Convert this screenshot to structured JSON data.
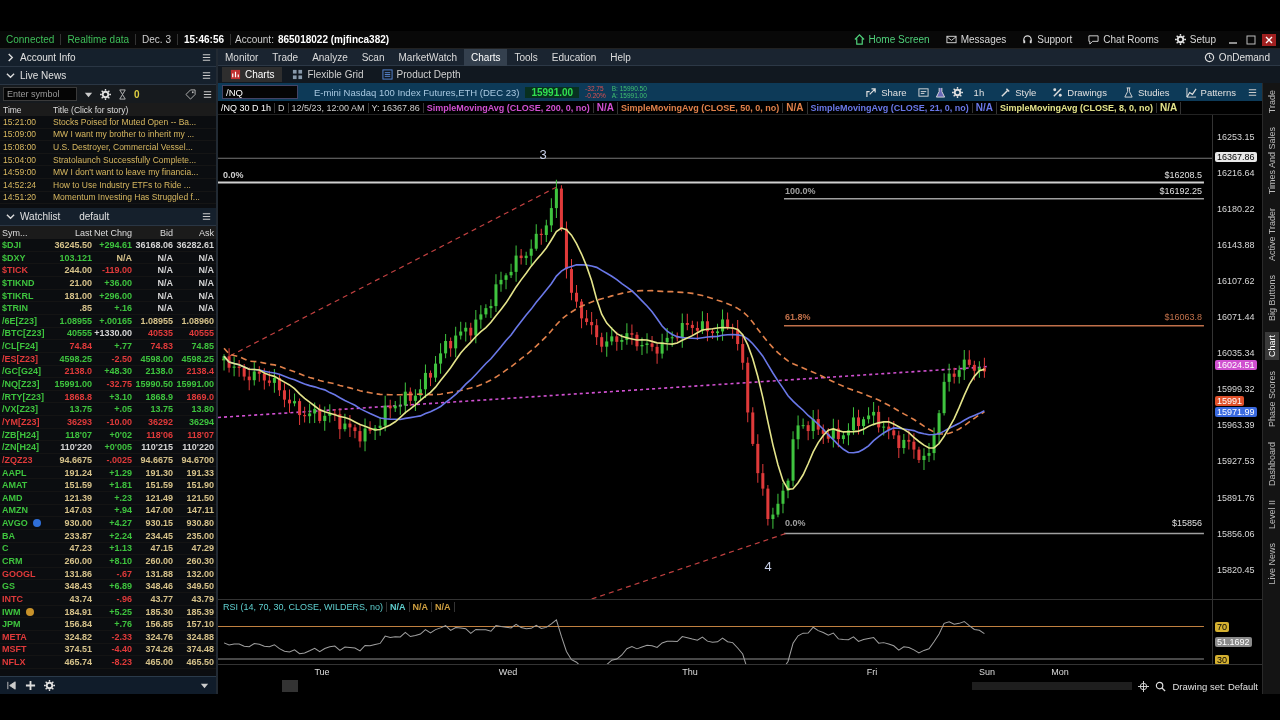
{
  "status_bar": {
    "connection": "Connected",
    "data_feed": "Realtime data",
    "date": "Dec. 3",
    "time": "15:46:56",
    "account_label": "Account:",
    "account": "865018022 (mjfinca382)"
  },
  "top_links": [
    {
      "label": "Home Screen",
      "kind": "home"
    },
    {
      "label": "Messages",
      "kind": "mail"
    },
    {
      "label": "Support",
      "kind": "headset"
    },
    {
      "label": "Chat Rooms",
      "kind": "chat"
    },
    {
      "label": "Setup",
      "kind": "gear"
    }
  ],
  "left_panel": {
    "sections": [
      {
        "title": "Account Info",
        "expanded": false
      },
      {
        "title": "Live News",
        "expanded": true
      }
    ],
    "symbol_field": {
      "placeholder": "Enter symbol"
    },
    "alert_count": "0",
    "news": {
      "columns": [
        "Time",
        "Title (Click for story)"
      ],
      "rows": [
        {
          "time": "15:21:00",
          "title": "Stocks Poised for Muted Open -- Ba..."
        },
        {
          "time": "15:09:00",
          "title": "MW I want my brother to inherit my ..."
        },
        {
          "time": "15:08:00",
          "title": "U.S. Destroyer, Commercial Vessel..."
        },
        {
          "time": "15:04:00",
          "title": "Stratolaunch Successfully Complete..."
        },
        {
          "time": "14:59:00",
          "title": "MW I don't want to leave my financia..."
        },
        {
          "time": "14:52:24",
          "title": "How to Use Industry ETFs to Ride ..."
        },
        {
          "time": "14:51:20",
          "title": "Momentum Investing Has Struggled f..."
        }
      ]
    },
    "watchlist": {
      "title": "Watchlist",
      "name": "default",
      "columns": [
        "Sym...",
        "Last",
        "Net Chng",
        "Bid",
        "Ask"
      ],
      "rows": [
        {
          "cells": [
            {
              "text": "$DJI",
              "color": "#3ec43e"
            },
            {
              "text": "36245.50",
              "color": "#d6c28a"
            },
            {
              "text": "+294.61",
              "color": "#3ec43e"
            },
            {
              "text": "36168.06",
              "color": "#d4d4d4"
            },
            {
              "text": "36282.61",
              "color": "#d4d4d4"
            }
          ]
        },
        {
          "cells": [
            {
              "text": "$DXY",
              "color": "#3ec43e"
            },
            {
              "text": "103.121",
              "color": "#3ec43e"
            },
            {
              "text": "N/A",
              "color": "#d6c28a"
            },
            {
              "text": "N/A",
              "color": "#d4d4d4"
            },
            {
              "text": "N/A",
              "color": "#d4d4d4"
            }
          ]
        },
        {
          "cells": [
            {
              "text": "$TICK",
              "color": "#e03a3a"
            },
            {
              "text": "244.00",
              "color": "#d6c28a"
            },
            {
              "text": "-119.00",
              "color": "#e03a3a"
            },
            {
              "text": "N/A",
              "color": "#d4d4d4"
            },
            {
              "text": "N/A",
              "color": "#d4d4d4"
            }
          ]
        },
        {
          "cells": [
            {
              "text": "$TIKND",
              "color": "#3ec43e"
            },
            {
              "text": "21.00",
              "color": "#d6c28a"
            },
            {
              "text": "+36.00",
              "color": "#3ec43e"
            },
            {
              "text": "N/A",
              "color": "#d4d4d4"
            },
            {
              "text": "N/A",
              "color": "#d4d4d4"
            }
          ]
        },
        {
          "cells": [
            {
              "text": "$TIKRL",
              "color": "#3ec43e"
            },
            {
              "text": "181.00",
              "color": "#d6c28a"
            },
            {
              "text": "+296.00",
              "color": "#3ec43e"
            },
            {
              "text": "N/A",
              "color": "#d4d4d4"
            },
            {
              "text": "N/A",
              "color": "#d4d4d4"
            }
          ]
        },
        {
          "cells": [
            {
              "text": "$TRIN",
              "color": "#3ec43e"
            },
            {
              "text": ".85",
              "color": "#d6c28a"
            },
            {
              "text": "+.16",
              "color": "#3ec43e"
            },
            {
              "text": "N/A",
              "color": "#d4d4d4"
            },
            {
              "text": "N/A",
              "color": "#d4d4d4"
            }
          ]
        },
        {
          "cells": [
            {
              "text": "/6E[Z23]",
              "color": "#3ec43e"
            },
            {
              "text": "1.08955",
              "color": "#3ec43e"
            },
            {
              "text": "+.00165",
              "color": "#3ec43e"
            },
            {
              "text": "1.08955",
              "color": "#d6c28a"
            },
            {
              "text": "1.08960",
              "color": "#d6c28a"
            }
          ]
        },
        {
          "cells": [
            {
              "text": "/BTC[Z23]",
              "color": "#3ec43e"
            },
            {
              "text": "40555",
              "color": "#3ec43e"
            },
            {
              "text": "+1330.00",
              "color": "#d4d4d4"
            },
            {
              "text": "40535",
              "color": "#e03a3a"
            },
            {
              "text": "40555",
              "color": "#e03a3a"
            }
          ]
        },
        {
          "cells": [
            {
              "text": "/CL[F24]",
              "color": "#3ec43e"
            },
            {
              "text": "74.84",
              "color": "#e03a3a"
            },
            {
              "text": "+.77",
              "color": "#3ec43e"
            },
            {
              "text": "74.83",
              "color": "#e03a3a"
            },
            {
              "text": "74.85",
              "color": "#3ec43e"
            }
          ]
        },
        {
          "cells": [
            {
              "text": "/ES[Z23]",
              "color": "#e03a3a"
            },
            {
              "text": "4598.25",
              "color": "#3ec43e"
            },
            {
              "text": "-2.50",
              "color": "#e03a3a"
            },
            {
              "text": "4598.00",
              "color": "#3ec43e"
            },
            {
              "text": "4598.25",
              "color": "#3ec43e"
            }
          ]
        },
        {
          "cells": [
            {
              "text": "/GC[G24]",
              "color": "#3ec43e"
            },
            {
              "text": "2138.0",
              "color": "#e03a3a"
            },
            {
              "text": "+48.30",
              "color": "#3ec43e"
            },
            {
              "text": "2138.0",
              "color": "#3ec43e"
            },
            {
              "text": "2138.4",
              "color": "#e03a3a"
            }
          ]
        },
        {
          "cells": [
            {
              "text": "/NQ[Z23]",
              "color": "#3ec43e"
            },
            {
              "text": "15991.00",
              "color": "#3ec43e"
            },
            {
              "text": "-32.75",
              "color": "#e03a3a"
            },
            {
              "text": "15990.50",
              "color": "#3ec43e"
            },
            {
              "text": "15991.00",
              "color": "#3ec43e"
            }
          ]
        },
        {
          "cells": [
            {
              "text": "/RTY[Z23]",
              "color": "#3ec43e"
            },
            {
              "text": "1868.8",
              "color": "#e03a3a"
            },
            {
              "text": "+3.10",
              "color": "#3ec43e"
            },
            {
              "text": "1868.9",
              "color": "#3ec43e"
            },
            {
              "text": "1869.0",
              "color": "#e03a3a"
            }
          ]
        },
        {
          "cells": [
            {
              "text": "/VX[Z23]",
              "color": "#3ec43e"
            },
            {
              "text": "13.75",
              "color": "#3ec43e"
            },
            {
              "text": "+.05",
              "color": "#3ec43e"
            },
            {
              "text": "13.75",
              "color": "#3ec43e"
            },
            {
              "text": "13.80",
              "color": "#3ec43e"
            }
          ]
        },
        {
          "cells": [
            {
              "text": "/YM[Z23]",
              "color": "#e03a3a"
            },
            {
              "text": "36293",
              "color": "#e03a3a"
            },
            {
              "text": "-10.00",
              "color": "#e03a3a"
            },
            {
              "text": "36292",
              "color": "#e03a3a"
            },
            {
              "text": "36294",
              "color": "#3ec43e"
            }
          ]
        },
        {
          "cells": [
            {
              "text": "/ZB[H24]",
              "color": "#3ec43e"
            },
            {
              "text": "118'07",
              "color": "#3ec43e"
            },
            {
              "text": "+0'02",
              "color": "#3ec43e"
            },
            {
              "text": "118'06",
              "color": "#e03a3a"
            },
            {
              "text": "118'07",
              "color": "#e03a3a"
            }
          ]
        },
        {
          "cells": [
            {
              "text": "/ZN[H24]",
              "color": "#3ec43e"
            },
            {
              "text": "110'220",
              "color": "#d4d4d4"
            },
            {
              "text": "+0'005",
              "color": "#3ec43e"
            },
            {
              "text": "110'215",
              "color": "#d4d4d4"
            },
            {
              "text": "110'220",
              "color": "#d4d4d4"
            }
          ]
        },
        {
          "cells": [
            {
              "text": "/ZQZ23",
              "color": "#e03a3a"
            },
            {
              "text": "94.6675",
              "color": "#d6c28a"
            },
            {
              "text": "-.0025",
              "color": "#e03a3a"
            },
            {
              "text": "94.6675",
              "color": "#d6c28a"
            },
            {
              "text": "94.6700",
              "color": "#d6c28a"
            }
          ]
        },
        {
          "cells": [
            {
              "text": "AAPL",
              "color": "#3ec43e"
            },
            {
              "text": "191.24",
              "color": "#d6c28a"
            },
            {
              "text": "+1.29",
              "color": "#3ec43e"
            },
            {
              "text": "191.30",
              "color": "#d6c28a"
            },
            {
              "text": "191.33",
              "color": "#d6c28a"
            }
          ]
        },
        {
          "cells": [
            {
              "text": "AMAT",
              "color": "#3ec43e"
            },
            {
              "text": "151.59",
              "color": "#d6c28a"
            },
            {
              "text": "+1.81",
              "color": "#3ec43e"
            },
            {
              "text": "151.59",
              "color": "#d6c28a"
            },
            {
              "text": "151.90",
              "color": "#d6c28a"
            }
          ]
        },
        {
          "cells": [
            {
              "text": "AMD",
              "color": "#3ec43e"
            },
            {
              "text": "121.39",
              "color": "#d6c28a"
            },
            {
              "text": "+.23",
              "color": "#3ec43e"
            },
            {
              "text": "121.49",
              "color": "#d6c28a"
            },
            {
              "text": "121.50",
              "color": "#d6c28a"
            }
          ]
        },
        {
          "cells": [
            {
              "text": "AMZN",
              "color": "#3ec43e"
            },
            {
              "text": "147.03",
              "color": "#d6c28a"
            },
            {
              "text": "+.94",
              "color": "#3ec43e"
            },
            {
              "text": "147.00",
              "color": "#d6c28a"
            },
            {
              "text": "147.11",
              "color": "#d6c28a"
            }
          ]
        },
        {
          "badge": {
            "color": "#2f6fd8"
          },
          "cells": [
            {
              "text": "AVGO",
              "color": "#3ec43e"
            },
            {
              "text": "930.00",
              "color": "#d6c28a"
            },
            {
              "text": "+4.27",
              "color": "#3ec43e"
            },
            {
              "text": "930.15",
              "color": "#d6c28a"
            },
            {
              "text": "930.80",
              "color": "#d6c28a"
            }
          ]
        },
        {
          "cells": [
            {
              "text": "BA",
              "color": "#3ec43e"
            },
            {
              "text": "233.87",
              "color": "#d6c28a"
            },
            {
              "text": "+2.24",
              "color": "#3ec43e"
            },
            {
              "text": "234.45",
              "color": "#d6c28a"
            },
            {
              "text": "235.00",
              "color": "#d6c28a"
            }
          ]
        },
        {
          "cells": [
            {
              "text": "C",
              "color": "#3ec43e"
            },
            {
              "text": "47.23",
              "color": "#d6c28a"
            },
            {
              "text": "+1.13",
              "color": "#3ec43e"
            },
            {
              "text": "47.15",
              "color": "#d6c28a"
            },
            {
              "text": "47.29",
              "color": "#d6c28a"
            }
          ]
        },
        {
          "cells": [
            {
              "text": "CRM",
              "color": "#3ec43e"
            },
            {
              "text": "260.00",
              "color": "#d6c28a"
            },
            {
              "text": "+8.10",
              "color": "#3ec43e"
            },
            {
              "text": "260.00",
              "color": "#d6c28a"
            },
            {
              "text": "260.30",
              "color": "#d6c28a"
            }
          ]
        },
        {
          "cells": [
            {
              "text": "GOOGL",
              "color": "#e03a3a"
            },
            {
              "text": "131.86",
              "color": "#d6c28a"
            },
            {
              "text": "-.67",
              "color": "#e03a3a"
            },
            {
              "text": "131.88",
              "color": "#d6c28a"
            },
            {
              "text": "132.00",
              "color": "#d6c28a"
            }
          ]
        },
        {
          "cells": [
            {
              "text": "GS",
              "color": "#3ec43e"
            },
            {
              "text": "348.43",
              "color": "#d6c28a"
            },
            {
              "text": "+6.89",
              "color": "#3ec43e"
            },
            {
              "text": "348.46",
              "color": "#d6c28a"
            },
            {
              "text": "349.50",
              "color": "#d6c28a"
            }
          ]
        },
        {
          "cells": [
            {
              "text": "INTC",
              "color": "#e03a3a"
            },
            {
              "text": "43.74",
              "color": "#d6c28a"
            },
            {
              "text": "-.96",
              "color": "#e03a3a"
            },
            {
              "text": "43.77",
              "color": "#d6c28a"
            },
            {
              "text": "43.79",
              "color": "#d6c28a"
            }
          ]
        },
        {
          "badge": {
            "color": "#c8922a"
          },
          "cells": [
            {
              "text": "IWM",
              "color": "#3ec43e"
            },
            {
              "text": "184.91",
              "color": "#d6c28a"
            },
            {
              "text": "+5.25",
              "color": "#3ec43e"
            },
            {
              "text": "185.30",
              "color": "#d6c28a"
            },
            {
              "text": "185.39",
              "color": "#d6c28a"
            }
          ]
        },
        {
          "cells": [
            {
              "text": "JPM",
              "color": "#3ec43e"
            },
            {
              "text": "156.84",
              "color": "#d6c28a"
            },
            {
              "text": "+.76",
              "color": "#3ec43e"
            },
            {
              "text": "156.85",
              "color": "#d6c28a"
            },
            {
              "text": "157.10",
              "color": "#d6c28a"
            }
          ]
        },
        {
          "cells": [
            {
              "text": "META",
              "color": "#e03a3a"
            },
            {
              "text": "324.82",
              "color": "#d6c28a"
            },
            {
              "text": "-2.33",
              "color": "#e03a3a"
            },
            {
              "text": "324.76",
              "color": "#d6c28a"
            },
            {
              "text": "324.88",
              "color": "#d6c28a"
            }
          ]
        },
        {
          "cells": [
            {
              "text": "MSFT",
              "color": "#e03a3a"
            },
            {
              "text": "374.51",
              "color": "#d6c28a"
            },
            {
              "text": "-4.40",
              "color": "#e03a3a"
            },
            {
              "text": "374.26",
              "color": "#d6c28a"
            },
            {
              "text": "374.48",
              "color": "#d6c28a"
            }
          ]
        },
        {
          "cells": [
            {
              "text": "NFLX",
              "color": "#e03a3a"
            },
            {
              "text": "465.74",
              "color": "#d6c28a"
            },
            {
              "text": "-8.23",
              "color": "#e03a3a"
            },
            {
              "text": "465.00",
              "color": "#d6c28a"
            },
            {
              "text": "465.50",
              "color": "#d6c28a"
            }
          ]
        }
      ]
    }
  },
  "menu": {
    "tabs": [
      {
        "label": "Monitor",
        "selected": false
      },
      {
        "label": "Trade",
        "selected": false
      },
      {
        "label": "Analyze",
        "selected": false
      },
      {
        "label": "Scan",
        "selected": false
      },
      {
        "label": "MarketWatch",
        "selected": false
      },
      {
        "label": "Charts",
        "selected": true
      },
      {
        "label": "Tools",
        "selected": false
      },
      {
        "label": "Education",
        "selected": false
      },
      {
        "label": "Help",
        "selected": false
      }
    ],
    "on_demand": "OnDemand"
  },
  "sub_tabs": [
    {
      "label": "Charts",
      "selected": true
    },
    {
      "label": "Flexible Grid",
      "selected": false
    },
    {
      "label": "Product Depth",
      "selected": false
    }
  ],
  "chart_toolbar": {
    "symbol": "/NQ",
    "description": "E-mini Nasdaq 100 Index Futures,ETH (DEC 23)",
    "last": "15991.00",
    "change": "-32.75",
    "change_pct": "-0.20%",
    "bid": "B: 15990.50",
    "ask": "A: 15991.00",
    "buttons": [
      {
        "label": "Share",
        "kind": "share"
      },
      {
        "label": "1h",
        "kind": "plain"
      },
      {
        "label": "Style",
        "kind": "style"
      },
      {
        "label": "Drawings",
        "kind": "drawings"
      },
      {
        "label": "Studies",
        "kind": "studies"
      },
      {
        "label": "Patterns",
        "kind": "patterns"
      }
    ]
  },
  "study_header": {
    "symbol": "/NQ 30 D 1h",
    "bar": "D",
    "date": "12/5/23, 12:00 AM",
    "y": "Y: 16367.86",
    "studies": [
      {
        "label": "SimpleMovingAvg (CLOSE, 200, 0, no)",
        "value": "N/A",
        "color": "#d050d0"
      },
      {
        "label": "SimpleMovingAvg (CLOSE, 50, 0, no)",
        "value": "N/A",
        "color": "#e0804a"
      },
      {
        "label": "SimpleMovingAvg (CLOSE, 21, 0, no)",
        "value": "N/A",
        "color": "#6a78e8"
      },
      {
        "label": "SimpleMovingAvg (CLOSE, 8, 0, no)",
        "value": "N/A",
        "color": "#e4e48a"
      }
    ]
  },
  "price_chart": {
    "wave_labels": [
      "3",
      "4"
    ],
    "fib_levels": [
      {
        "percent": "0.0%",
        "price": "$16208.5",
        "color": "#d0d0d0"
      },
      {
        "percent": "100.0%",
        "price": "$16192.25",
        "color": "#a0a0a0"
      },
      {
        "percent": "61.8%",
        "price": "$16063.8",
        "color": "#c0704a"
      },
      {
        "percent": "0.0%",
        "price": "$15856",
        "color": "#a0a0a0"
      }
    ],
    "axis": [
      "16253.15",
      "16216.64",
      "16180.22",
      "16143.88",
      "16107.62",
      "16071.44",
      "16035.34",
      "15999.32",
      "15963.39",
      "15927.53",
      "15891.76",
      "15856.06",
      "15820.45"
    ],
    "bubbles": [
      {
        "text": "16367.86",
        "color": "#e8e8e8"
      },
      {
        "text": "16024.51",
        "color": "#d050d0"
      },
      {
        "text": "15991",
        "color": "#e0502a"
      },
      {
        "text": "15971.99",
        "color": "#3a6ae0"
      }
    ]
  },
  "rsi": {
    "title": "RSI (14, 70, 30, CLOSE, WILDERS, no)",
    "values": [
      {
        "text": "N/A",
        "color": "#5fd0d0"
      },
      {
        "text": "N/A",
        "color": "#d0a040"
      },
      {
        "text": "N/A",
        "color": "#d0a040"
      }
    ],
    "axis": [
      {
        "text": "70",
        "color": "#d4b030"
      },
      {
        "text": "51.1692",
        "color": "#8a8a8a"
      },
      {
        "text": "30",
        "color": "#d4b030"
      }
    ]
  },
  "time_axis": [
    "Tue",
    "Wed",
    "Thu",
    "Fri",
    "Sun",
    "Mon"
  ],
  "drawing_set": "Drawing set: Default",
  "side_tabs": [
    {
      "label": "Trade",
      "selected": false
    },
    {
      "label": "Times And Sales",
      "selected": false
    },
    {
      "label": "Active Trader",
      "selected": false
    },
    {
      "label": "Big Buttons",
      "selected": false
    },
    {
      "label": "Chart",
      "selected": true
    },
    {
      "label": "Phase Scores",
      "selected": false
    },
    {
      "label": "Dashboard",
      "selected": false
    },
    {
      "label": "Level II",
      "selected": false
    },
    {
      "label": "Live News",
      "selected": false
    }
  ]
}
